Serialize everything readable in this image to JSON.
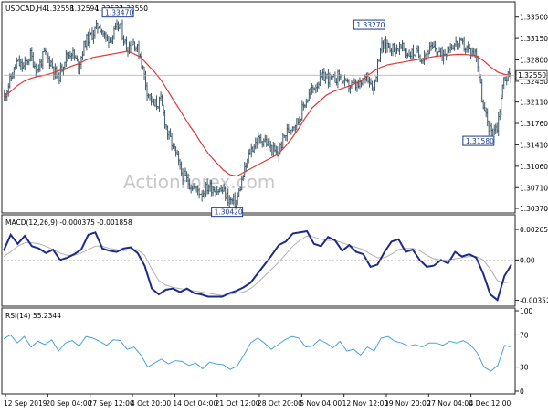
{
  "chart_data": [
    {
      "type": "bar",
      "subtype": "ohlc",
      "symbol": "USDCAD,H4",
      "header_values": [
        "1.32558",
        "1.32594",
        "1.32532",
        "1.32550"
      ],
      "ylim": [
        1.3037,
        1.3357
      ],
      "yticks": [
        "1.33500",
        "1.33150",
        "1.32800",
        "1.32450",
        "1.32110",
        "1.31760",
        "1.31410",
        "1.31060",
        "1.30710",
        "1.30370"
      ],
      "current_price": "1.32550",
      "annotations": [
        {
          "text": "1.33470",
          "value": 1.3347
        },
        {
          "text": "1.33270",
          "value": 1.3327
        },
        {
          "text": "1.31580",
          "value": 1.3158
        },
        {
          "text": "1.30420",
          "value": 1.3042
        }
      ],
      "price_path": [
        1.3215,
        1.3245,
        1.3275,
        1.3268,
        1.3288,
        1.3262,
        1.329,
        1.3276,
        1.3248,
        1.3282,
        1.3294,
        1.327,
        1.331,
        1.3322,
        1.3338,
        1.3314,
        1.332,
        1.3338,
        1.33,
        1.331,
        1.3288,
        1.323,
        1.3205,
        1.3212,
        1.316,
        1.3132,
        1.3095,
        1.308,
        1.307,
        1.3062,
        1.3074,
        1.3068,
        1.3066,
        1.305,
        1.3046,
        1.309,
        1.313,
        1.3148,
        1.315,
        1.3136,
        1.3124,
        1.3155,
        1.3172,
        1.318,
        1.321,
        1.323,
        1.3245,
        1.3254,
        1.3245,
        1.3255,
        1.3238,
        1.3238,
        1.3236,
        1.3258,
        1.3233,
        1.33,
        1.3305,
        1.3298,
        1.33,
        1.329,
        1.3292,
        1.3285,
        1.3296,
        1.3298,
        1.3288,
        1.3302,
        1.3306,
        1.3304,
        1.3295,
        1.329,
        1.32,
        1.3165,
        1.317,
        1.325,
        1.3255
      ],
      "moving_average": [
        1.322,
        1.3228,
        1.3238,
        1.3245,
        1.325,
        1.3253,
        1.3255,
        1.3258,
        1.3262,
        1.3266,
        1.327,
        1.3274,
        1.328,
        1.3284,
        1.3286,
        1.3288,
        1.329,
        1.3292,
        1.3294,
        1.329,
        1.3284,
        1.3272,
        1.326,
        1.3246,
        1.3228,
        1.321,
        1.3192,
        1.3174,
        1.3158,
        1.314,
        1.3124,
        1.3112,
        1.31,
        1.3092,
        1.309,
        1.3096,
        1.3102,
        1.3108,
        1.3114,
        1.312,
        1.3126,
        1.3138,
        1.3152,
        1.3168,
        1.3186,
        1.3202,
        1.3212,
        1.3222,
        1.3228,
        1.3232,
        1.3236,
        1.324,
        1.3245,
        1.3254,
        1.3262,
        1.3268,
        1.3272,
        1.3274,
        1.3276,
        1.3278,
        1.328,
        1.3282,
        1.3284,
        1.3286,
        1.3287,
        1.3288,
        1.3289,
        1.3289,
        1.3288,
        1.3286,
        1.3278,
        1.3268,
        1.326,
        1.3256,
        1.3255
      ],
      "watermark": "ActionForex.com"
    },
    {
      "type": "line",
      "title": "MACD(12,26,9) -0.000375 -0.001858",
      "ylim": [
        -0.0038,
        0.0029
      ],
      "yticks": [
        "0.002652",
        "0.00",
        "-0.003526"
      ],
      "series": [
        {
          "values": [
            0.0008,
            0.0022,
            0.0014,
            0.0021,
            0.0012,
            0.001,
            0.0006,
            0.0009,
            0.0,
            0.0002,
            0.0005,
            0.0009,
            0.0022,
            0.0024,
            0.001,
            0.0008,
            0.0007,
            0.001,
            0.0011,
            0.0006,
            -0.0005,
            -0.0025,
            -0.003,
            -0.0026,
            -0.0025,
            -0.0028,
            -0.0025,
            -0.0029,
            -0.003,
            -0.0032,
            -0.0032,
            -0.0032,
            -0.0029,
            -0.0027,
            -0.0024,
            -0.002,
            -0.0012,
            -0.0004,
            0.0004,
            0.0013,
            0.0016,
            0.0023,
            0.0024,
            0.0025,
            0.0014,
            0.0012,
            0.002,
            0.0017,
            0.0008,
            0.0013,
            0.0007,
            0.0005,
            -0.0006,
            -0.0004,
            0.0007,
            0.0016,
            0.0018,
            0.0007,
            0.0009,
            0.0,
            -0.0006,
            -0.0005,
            0.0,
            -0.0003,
            0.0007,
            0.0003,
            0.0005,
            0.0002,
            -0.0012,
            -0.003,
            -0.0035,
            -0.0014,
            -0.0004
          ]
        },
        {
          "values": [
            0.0003,
            0.0007,
            0.0012,
            0.0015,
            0.0015,
            0.0014,
            0.0012,
            0.0009,
            0.0006,
            0.0004,
            0.0004,
            0.0006,
            0.0009,
            0.0012,
            0.0012,
            0.001,
            0.0009,
            0.0008,
            0.0009,
            0.0009,
            0.0004,
            -0.0008,
            -0.0018,
            -0.0022,
            -0.0024,
            -0.0025,
            -0.0026,
            -0.0027,
            -0.0028,
            -0.0029,
            -0.003,
            -0.0031,
            -0.003,
            -0.0029,
            -0.0028,
            -0.0025,
            -0.002,
            -0.0014,
            -0.0008,
            -0.0002,
            0.0005,
            0.0012,
            0.0017,
            0.0021,
            0.002,
            0.0018,
            0.0017,
            0.0017,
            0.0015,
            0.0013,
            0.0011,
            0.0009,
            0.0005,
            0.0002,
            0.0002,
            0.0005,
            0.0009,
            0.001,
            0.001,
            0.0008,
            0.0004,
            0.0001,
            0.0,
            0.0,
            0.0001,
            0.0002,
            0.0003,
            0.0003,
            0.0,
            -0.0008,
            -0.0018,
            -0.002,
            -0.0019
          ]
        }
      ]
    },
    {
      "type": "line",
      "title": "RSI(14) 55.2344",
      "ylim": [
        0,
        100
      ],
      "yticks": [
        "100",
        "70",
        "30",
        "0"
      ],
      "levels": [
        70,
        30
      ],
      "series": [
        {
          "values": [
            65,
            70,
            60,
            68,
            55,
            62,
            58,
            64,
            50,
            60,
            63,
            56,
            68,
            66,
            62,
            57,
            64,
            63,
            52,
            55,
            45,
            30,
            35,
            40,
            34,
            38,
            37,
            32,
            35,
            28,
            36,
            34,
            33,
            27,
            31,
            45,
            60,
            66,
            60,
            52,
            58,
            64,
            68,
            66,
            55,
            56,
            64,
            60,
            54,
            62,
            50,
            52,
            45,
            55,
            50,
            66,
            68,
            62,
            60,
            56,
            58,
            55,
            60,
            60,
            57,
            62,
            60,
            63,
            58,
            48,
            30,
            25,
            32,
            57,
            55
          ]
        }
      ],
      "xticks": [
        "12 Sep 2019",
        "20 Sep 04:00",
        "27 Sep 12:00",
        "4 Oct 20:00",
        "14 Oct 04:00",
        "21 Oct 12:00",
        "28 Oct 20:00",
        "5 Nov 04:00",
        "12 Nov 12:00",
        "19 Nov 20:00",
        "27 Nov 04:00",
        "4 Dec 12:00"
      ]
    }
  ],
  "colors": {
    "price": "#3d5a6a",
    "moving_average": "#e03a35",
    "macd_line": "#1c2a8c",
    "macd_signal": "#b0b0b0",
    "rsi": "#4aa3de",
    "label_box": "#1a3a8a",
    "current_line": "#aaaaaa"
  }
}
